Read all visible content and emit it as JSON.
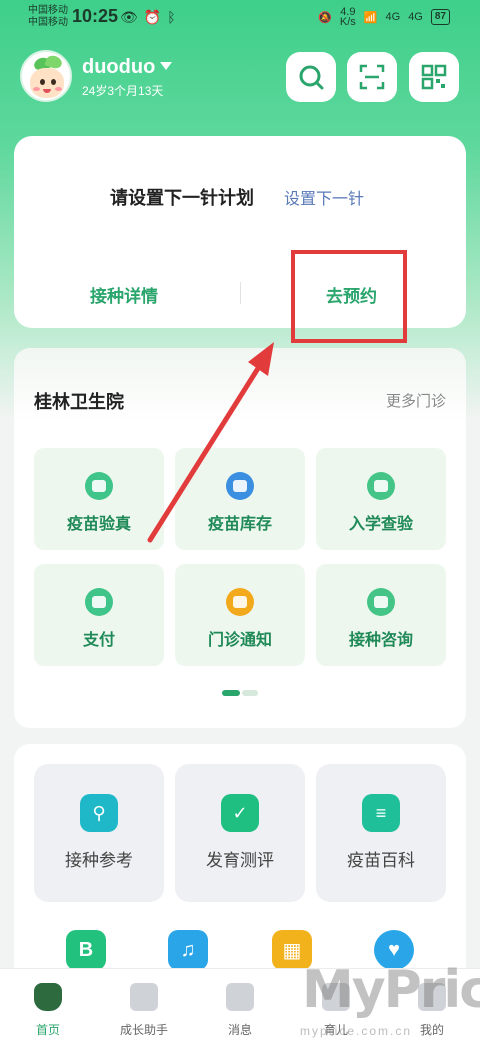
{
  "status_bar": {
    "carrier1": "中国移动",
    "carrier2": "中国移动",
    "time": "10:25",
    "speed_value": "4.9",
    "speed_unit": "K/s",
    "network1": "4G",
    "network2": "4G",
    "battery": "87"
  },
  "header": {
    "user_name": "duoduo",
    "user_age": "24岁3个月13天",
    "buttons": [
      "search-icon",
      "scan-icon",
      "qrcode-icon"
    ]
  },
  "plan": {
    "title": "请设置下一针计划",
    "link": "设置下一针",
    "detail_button": "接种详情",
    "book_button": "去预约"
  },
  "clinic": {
    "name": "桂林卫生院",
    "more": "更多门诊",
    "tiles": [
      {
        "label": "疫苗验真",
        "color": "#3fc48a"
      },
      {
        "label": "疫苗库存",
        "color": "#3b8fe0"
      },
      {
        "label": "入学查验",
        "color": "#45c487"
      },
      {
        "label": "支付",
        "color": "#3fc48a"
      },
      {
        "label": "门诊通知",
        "color": "#f2a91c"
      },
      {
        "label": "接种咨询",
        "color": "#45c487"
      }
    ]
  },
  "tools": {
    "items": [
      {
        "label": "接种参考",
        "color": "#1fb8c9"
      },
      {
        "label": "发育测评",
        "color": "#1fbf82"
      },
      {
        "label": "疫苗百科",
        "color": "#1fbf9a"
      }
    ]
  },
  "bottom_nav": {
    "items": [
      {
        "label": "首页"
      },
      {
        "label": "成长助手"
      },
      {
        "label": "消息"
      },
      {
        "label": "育儿"
      },
      {
        "label": "我的"
      }
    ]
  },
  "watermark": {
    "main": "MyPrice",
    "sub": "myprice.com.cn"
  }
}
